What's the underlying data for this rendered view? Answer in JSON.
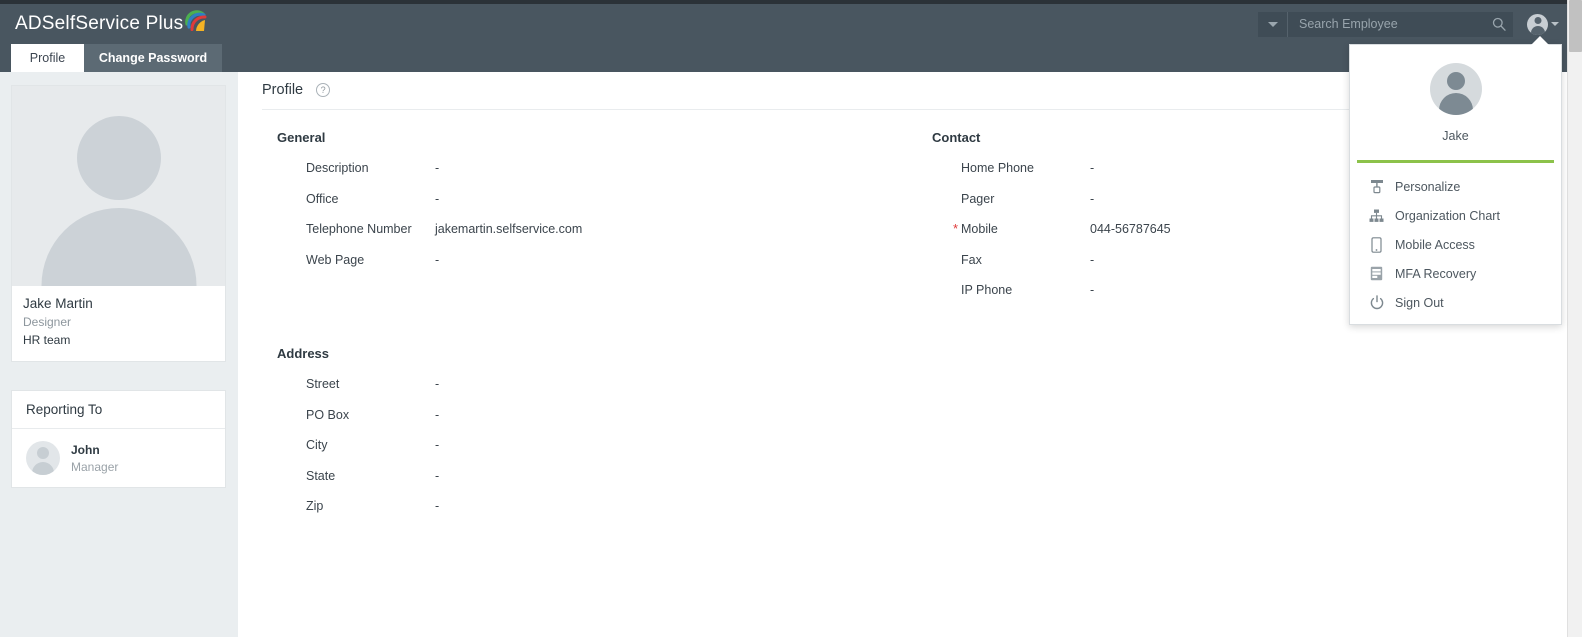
{
  "header": {
    "logo_text": "ADSelfService Plus",
    "logo_icon": "swoosh-logo",
    "search": {
      "placeholder": "Search Employee",
      "value": "",
      "dropdown_icon": "chevron-down-icon",
      "search_icon": "magnifier-icon"
    },
    "account_icon": "user-avatar-icon",
    "account_caret_icon": "caret-down-icon"
  },
  "tabs": [
    {
      "label": "Profile",
      "active": true
    },
    {
      "label": "Change Password",
      "active": false
    }
  ],
  "sidebar": {
    "photo_icon": "user-placeholder-photo",
    "profile": {
      "name": "Jake Martin",
      "role": "Designer",
      "team": "HR team"
    },
    "reporting": {
      "title": "Reporting To",
      "avatar_icon": "user-avatar-icon",
      "name": "John",
      "role": "Manager"
    }
  },
  "main": {
    "page_title": "Profile",
    "help_icon": "question-mark-icon",
    "help_glyph": "?",
    "general": {
      "title": "General",
      "fields": [
        {
          "label": "Description",
          "value": "-",
          "required": false
        },
        {
          "label": "Office",
          "value": "-",
          "required": false
        },
        {
          "label": "Telephone Number",
          "value": "jakemartin.selfservice.com",
          "required": false
        },
        {
          "label": "Web Page",
          "value": "-",
          "required": false
        }
      ]
    },
    "contact": {
      "title": "Contact",
      "fields": [
        {
          "label": "Home Phone",
          "value": "-",
          "required": false
        },
        {
          "label": "Pager",
          "value": "-",
          "required": false
        },
        {
          "label": "Mobile",
          "value": "044-56787645",
          "required": true
        },
        {
          "label": "Fax",
          "value": "-",
          "required": false
        },
        {
          "label": "IP Phone",
          "value": "-",
          "required": false
        }
      ]
    },
    "address": {
      "title": "Address",
      "fields": [
        {
          "label": "Street",
          "value": "-",
          "required": false
        },
        {
          "label": "PO Box",
          "value": "-",
          "required": false
        },
        {
          "label": "City",
          "value": "-",
          "required": false
        },
        {
          "label": "State",
          "value": "-",
          "required": false
        },
        {
          "label": "Zip",
          "value": "-",
          "required": false
        }
      ]
    }
  },
  "account_menu": {
    "avatar_icon": "user-avatar-icon",
    "name": "Jake",
    "items": [
      {
        "label": "Personalize",
        "icon": "paint-roller-icon"
      },
      {
        "label": "Organization Chart",
        "icon": "org-chart-icon"
      },
      {
        "label": "Mobile Access",
        "icon": "mobile-phone-icon"
      },
      {
        "label": "MFA Recovery",
        "icon": "recovery-codes-icon"
      },
      {
        "label": "Sign Out",
        "icon": "power-icon"
      }
    ]
  },
  "colors": {
    "header_bg": "#495660",
    "tab_inactive_bg": "#5c6a74",
    "sidebar_bg": "#eaeef0",
    "accent_green": "#8cc24a",
    "required_star": "#e03a3a",
    "text_primary": "#2f3a42",
    "text_muted": "#8d969d"
  },
  "required_star_glyph": "*"
}
